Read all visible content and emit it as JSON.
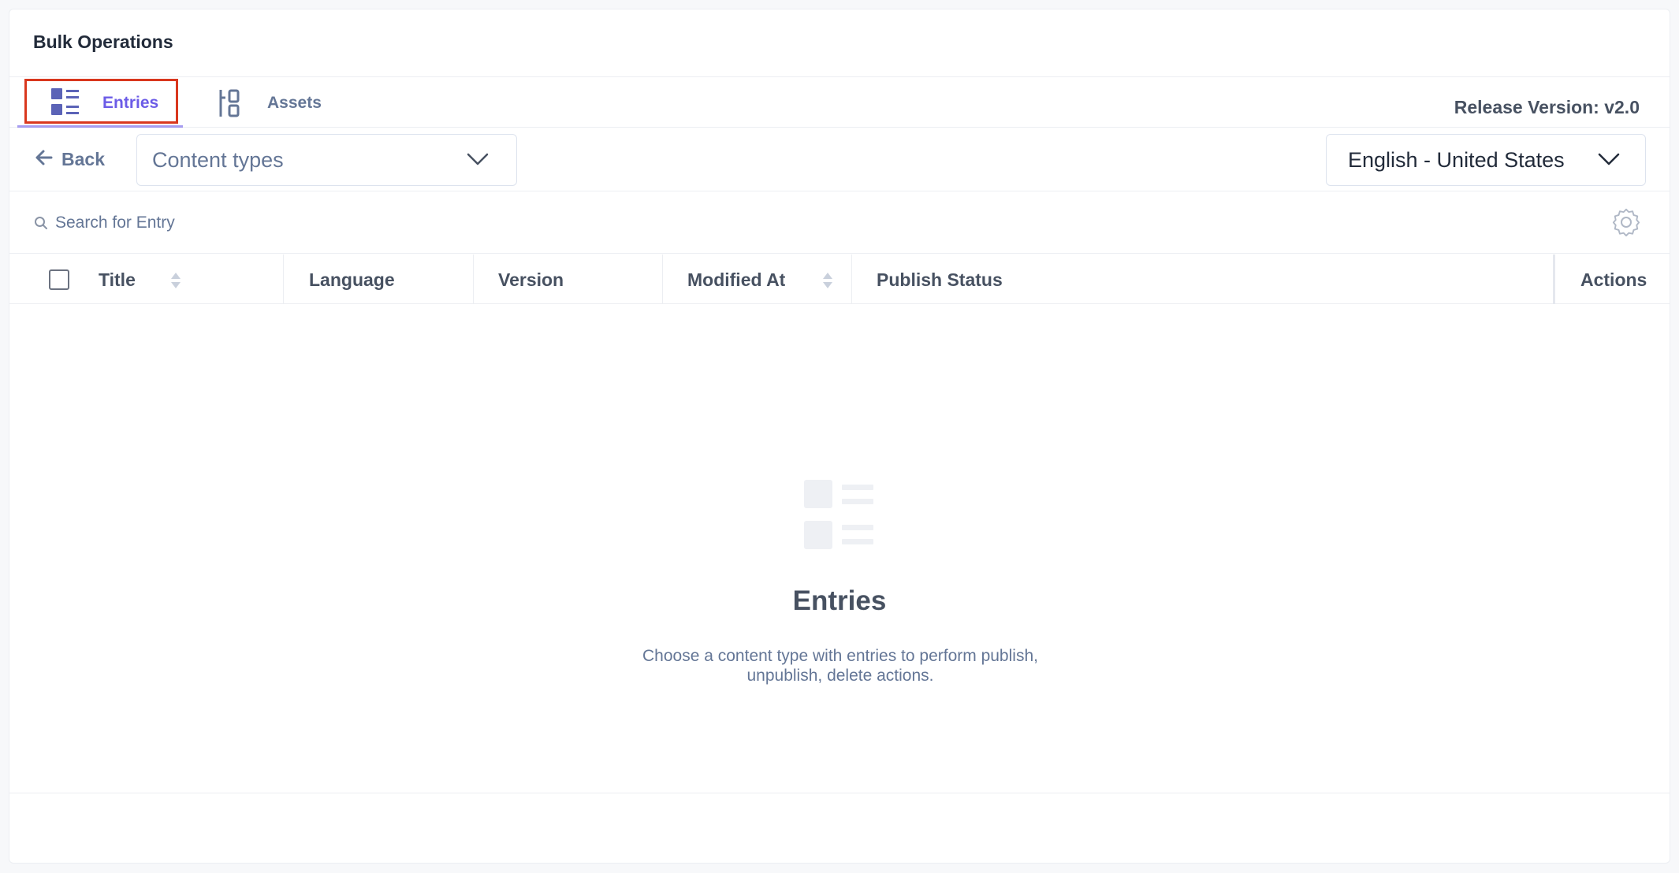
{
  "header": {
    "title": "Bulk Operations"
  },
  "tabs": [
    {
      "label": "Entries",
      "icon": "list-icon",
      "active": true
    },
    {
      "label": "Assets",
      "icon": "assets-icon",
      "active": false
    }
  ],
  "release": {
    "text": "Release Version: v2.0"
  },
  "toolbar": {
    "back_label": "Back",
    "content_type_value": "Content types",
    "locale_value": "English - United States"
  },
  "search": {
    "placeholder": "Search for Entry",
    "value": ""
  },
  "table": {
    "columns": [
      "Title",
      "Language",
      "Version",
      "Modified At",
      "Publish Status",
      "Actions"
    ],
    "rows": []
  },
  "empty_state": {
    "title": "Entries",
    "description": "Choose a content type with entries to perform publish, unpublish, delete actions."
  },
  "colors": {
    "accent": "#6c5ce7",
    "highlight_border": "#d9371e",
    "text_primary": "#222b3a",
    "text_secondary": "#647696"
  }
}
